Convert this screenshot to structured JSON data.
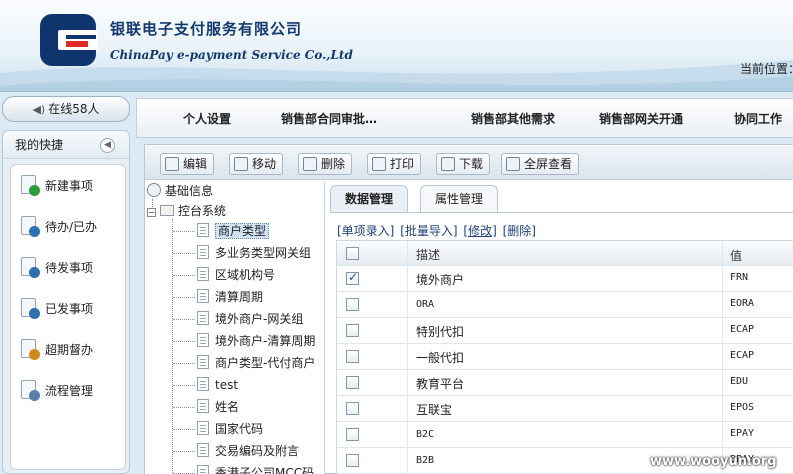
{
  "header": {
    "company_cn": "银联电子支付服务有限公司",
    "company_en": "ChinaPay e-payment Service Co.,Ltd",
    "location_label": "当前位置："
  },
  "sidebar": {
    "online": "在线58人",
    "quick_title": "我的快捷",
    "items": [
      {
        "label": "新建事项",
        "icon": "new-item-icon",
        "color": "#2e9b3a"
      },
      {
        "label": "待办/已办",
        "icon": "clock-icon",
        "color": "#2e6fb0"
      },
      {
        "label": "待发事项",
        "icon": "send-icon",
        "color": "#2e6fb0"
      },
      {
        "label": "已发事项",
        "icon": "check-icon",
        "color": "#2e6fb0"
      },
      {
        "label": "超期督办",
        "icon": "warning-icon",
        "color": "#d08a1e"
      },
      {
        "label": "流程管理",
        "icon": "flow-icon",
        "color": "#5a7fa8"
      }
    ]
  },
  "topnav": {
    "items": [
      "个人设置",
      "销售部合同审批…",
      "销售部其他需求",
      "销售部网关开通",
      "协同工作"
    ]
  },
  "toolbar": {
    "buttons": [
      "编辑",
      "移动",
      "删除",
      "打印",
      "下载",
      "全屏查看"
    ]
  },
  "tree": {
    "root": "基础信息",
    "group": "控台系统",
    "items": [
      "商户类型",
      "多业务类型网关组",
      "区域机构号",
      "清算周期",
      "境外商户-网关组",
      "境外商户-清算周期",
      "商户类型-代付商户",
      "test",
      "姓名",
      "国家代码",
      "交易编码及附言",
      "香港子公司MCC码"
    ],
    "selected_index": 0
  },
  "tabs": [
    "数据管理",
    "属性管理"
  ],
  "actions": [
    "[单项录入]",
    "[批量导入]",
    "[修改]",
    "[删除]"
  ],
  "grid": {
    "headers": [
      "描述",
      "值"
    ],
    "rows": [
      {
        "desc": "境外商户",
        "value": "FRN",
        "checked": true
      },
      {
        "desc": "ORA",
        "value": "EORA",
        "checked": false
      },
      {
        "desc": "特别代扣",
        "value": "ECAP",
        "checked": false
      },
      {
        "desc": "一般代扣",
        "value": "ECAP",
        "checked": false
      },
      {
        "desc": "教育平台",
        "value": "EDU",
        "checked": false
      },
      {
        "desc": "互联宝",
        "value": "EPOS",
        "checked": false
      },
      {
        "desc": "B2C",
        "value": "EPAY",
        "checked": false
      },
      {
        "desc": "B2B",
        "value": "BPAY",
        "checked": false
      }
    ]
  },
  "watermark": "www.wooyun.org"
}
